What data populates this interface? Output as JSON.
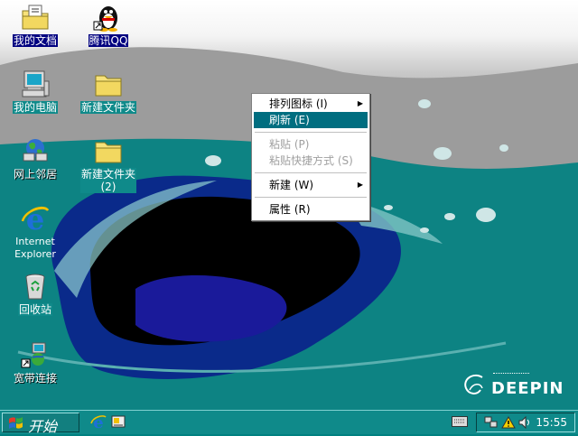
{
  "desktop_icons": [
    {
      "id": "my-documents",
      "label": "我的文档",
      "icon": "folder-documents-icon"
    },
    {
      "id": "tencent-qq",
      "label": "腾讯QQ",
      "icon": "qq-penguin-icon"
    },
    {
      "id": "my-computer",
      "label": "我的电脑",
      "icon": "computer-icon"
    },
    {
      "id": "new-folder",
      "label": "新建文件夹",
      "icon": "folder-icon"
    },
    {
      "id": "network-places",
      "label": "网上邻居",
      "icon": "network-icon"
    },
    {
      "id": "new-folder-2",
      "label": "新建文件夹\n(2)",
      "icon": "folder-icon"
    },
    {
      "id": "internet-explorer",
      "label": "Internet\nExplorer",
      "icon": "ie-icon"
    },
    {
      "id": "recycle-bin",
      "label": "回收站",
      "icon": "recycle-bin-icon"
    },
    {
      "id": "broadband",
      "label": "宽带连接",
      "icon": "broadband-connection-icon"
    }
  ],
  "context_menu": {
    "items": [
      {
        "label": "排列图标 (I)",
        "submenu": true,
        "state": "normal"
      },
      {
        "label": "刷新 (E)",
        "submenu": false,
        "state": "highlighted"
      },
      {
        "label": "粘贴 (P)",
        "submenu": false,
        "state": "disabled"
      },
      {
        "label": "粘贴快捷方式 (S)",
        "submenu": false,
        "state": "disabled"
      },
      {
        "label": "新建 (W)",
        "submenu": true,
        "state": "normal"
      },
      {
        "label": "属性 (R)",
        "submenu": false,
        "state": "normal"
      }
    ]
  },
  "wallpaper": {
    "logo_text": "DEEPIN"
  },
  "taskbar": {
    "start_label": "开始",
    "quick_launch": [
      "ie-icon",
      "show-desktop-icon"
    ],
    "tray_icons": [
      "network-icon",
      "warning-icon",
      "volume-icon"
    ],
    "clock": "15:55",
    "accent": "#0f8a8a"
  }
}
